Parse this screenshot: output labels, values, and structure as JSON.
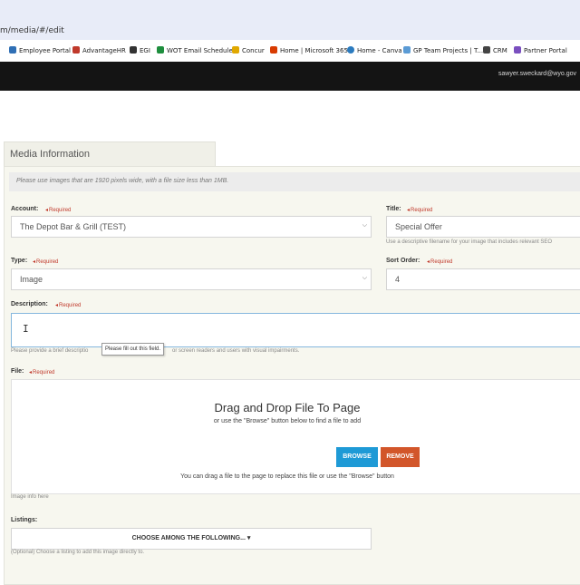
{
  "browser": {
    "url": "m/media/#/edit",
    "bookmarks": [
      {
        "label": "Employee Portal",
        "icon": "portal-icon",
        "color": "#2f6fb5"
      },
      {
        "label": "AdvantageHR",
        "icon": "advantagehr-icon",
        "color": "#c0392b"
      },
      {
        "label": "EGI",
        "icon": "egi-icon",
        "color": "#333333"
      },
      {
        "label": "WOT Email Schedule",
        "icon": "sheets-icon",
        "color": "#1e8e3e"
      },
      {
        "label": "Concur",
        "icon": "concur-icon",
        "color": "#e0a800"
      },
      {
        "label": "Home | Microsoft 365",
        "icon": "microsoft-icon",
        "color": "#d83b01"
      },
      {
        "label": "Home - Canva",
        "icon": "canva-icon",
        "color": "#2b7bbf"
      },
      {
        "label": "GP Team Projects | T...",
        "icon": "team-icon",
        "color": "#5b9bd5"
      },
      {
        "label": "CRM",
        "icon": "crm-icon",
        "color": "#444444"
      },
      {
        "label": "Partner Portal",
        "icon": "partner-icon",
        "color": "#7a4fbf"
      }
    ]
  },
  "header": {
    "user_email": "sawyer.sweckard@wyo.gov"
  },
  "panel": {
    "tab_label": "Media Information",
    "notice": "Please use images that are 1920 pixels wide, with a file size less than 1MB."
  },
  "form": {
    "required_label": "Required",
    "account": {
      "label": "Account:",
      "value": "The Depot Bar & Grill (TEST)"
    },
    "title": {
      "label": "Title:",
      "value": "Special Offer",
      "hint": "Use a descriptive filename for your image that includes relevant SEO"
    },
    "type": {
      "label": "Type:",
      "value": "Image"
    },
    "sort_order": {
      "label": "Sort Order:",
      "value": "4"
    },
    "description": {
      "label": "Description:",
      "value": "",
      "hint_start": "Please provide a brief descriptio",
      "hint_end": "or screen readers and users with visual impairments.",
      "tooltip": "Please fill out this field."
    },
    "file": {
      "label": "File:",
      "dropzone_title": "Drag and Drop File To Page",
      "dropzone_subtitle": "or use the \"Browse\" button below to find a file to add",
      "browse_label": "BROWSE",
      "remove_label": "REMOVE",
      "dropzone_footer": "You can drag a file to the page to replace this file or use the \"Browse\" button",
      "image_info": "Image info here"
    },
    "listings": {
      "label": "Listings:",
      "select_value": "CHOOSE AMONG THE FOLLOWING...",
      "hint": "(Optional) Choose a listing to add this image directly to."
    }
  },
  "colors": {
    "browse": "#1e9ad6",
    "remove": "#d2562a",
    "app_bar": "#141414",
    "required": "#c0392b"
  }
}
